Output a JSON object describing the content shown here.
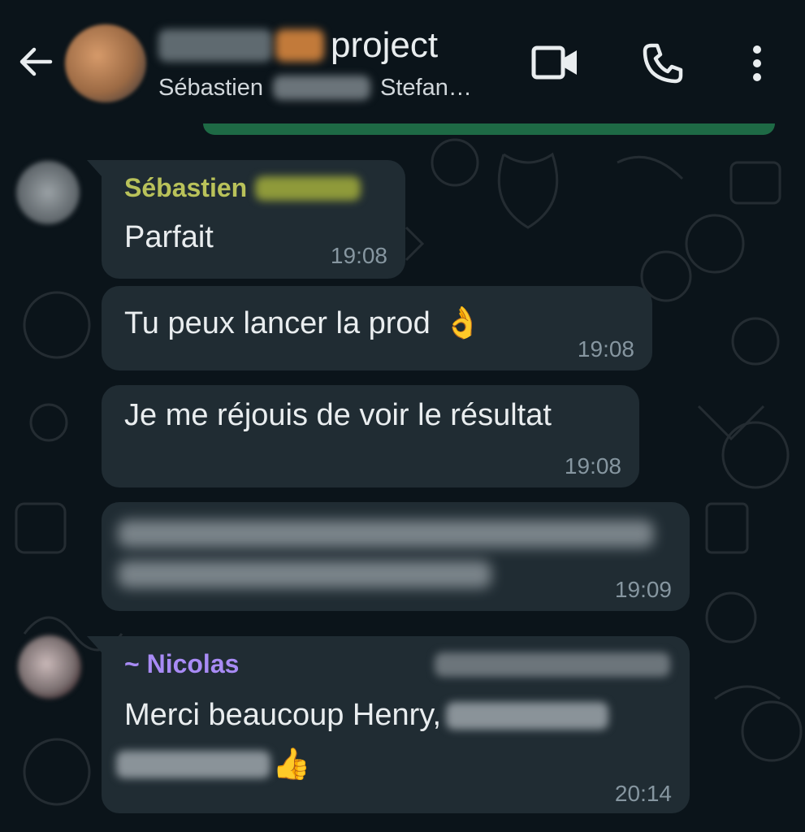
{
  "header": {
    "title_suffix": "project",
    "members_start": "Sébastien",
    "members_end": "Stefan…"
  },
  "messages": [
    {
      "sender": "Sébastien",
      "sender_color": "#b9c25a",
      "text": "Parfait",
      "time": "19:08"
    },
    {
      "text": "Tu peux lancer la prod",
      "emoji": "👌",
      "time": "19:08"
    },
    {
      "text": "Je me réjouis de voir le résultat",
      "time": "19:08"
    },
    {
      "text": "",
      "time": "19:09"
    },
    {
      "sender": "~ Nicolas",
      "sender_color": "#a88bf5",
      "text": "Merci beaucoup Henry,",
      "emoji": "👍",
      "time": "20:14"
    }
  ],
  "icons": {
    "back": "back-arrow-icon",
    "video": "video-call-icon",
    "phone": "voice-call-icon",
    "menu": "more-options-icon"
  },
  "colors": {
    "background": "#0b141a",
    "bubble": "#202c33",
    "pinned_bar": "#1e6a45",
    "timestamp": "#8696a0"
  }
}
